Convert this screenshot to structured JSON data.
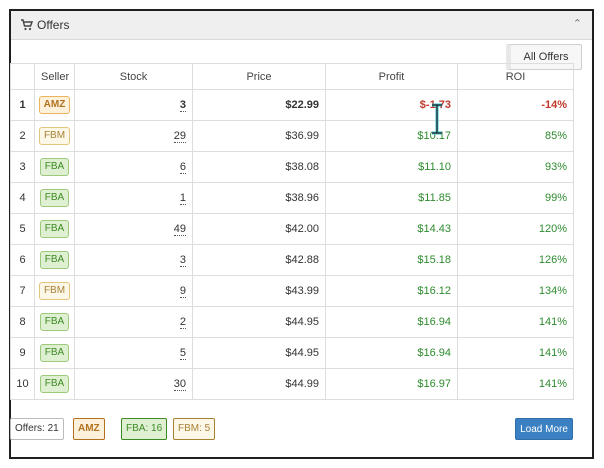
{
  "panel": {
    "title": "Offers",
    "collapse_icon": "chevron-up-icon",
    "cart_icon": "cart-icon"
  },
  "toolbar": {
    "all_offers_label": "All Offers"
  },
  "table": {
    "headers": [
      "",
      "Seller",
      "Stock",
      "Price",
      "Profit",
      "ROI"
    ],
    "rows": [
      {
        "idx": "1",
        "seller": "AMZ",
        "stock": "3",
        "price": "$22.99",
        "profit": "$-1.73",
        "roi": "-14%",
        "negative": true
      },
      {
        "idx": "2",
        "seller": "FBM",
        "stock": "29",
        "price": "$36.99",
        "profit": "$10.17",
        "roi": "85%"
      },
      {
        "idx": "3",
        "seller": "FBA",
        "stock": "6",
        "price": "$38.08",
        "profit": "$11.10",
        "roi": "93%"
      },
      {
        "idx": "4",
        "seller": "FBA",
        "stock": "1",
        "price": "$38.96",
        "profit": "$11.85",
        "roi": "99%"
      },
      {
        "idx": "5",
        "seller": "FBA",
        "stock": "49",
        "price": "$42.00",
        "profit": "$14.43",
        "roi": "120%"
      },
      {
        "idx": "6",
        "seller": "FBA",
        "stock": "3",
        "price": "$42.88",
        "profit": "$15.18",
        "roi": "126%"
      },
      {
        "idx": "7",
        "seller": "FBM",
        "stock": "9",
        "price": "$43.99",
        "profit": "$16.12",
        "roi": "134%"
      },
      {
        "idx": "8",
        "seller": "FBA",
        "stock": "2",
        "price": "$44.95",
        "profit": "$16.94",
        "roi": "141%"
      },
      {
        "idx": "9",
        "seller": "FBA",
        "stock": "5",
        "price": "$44.95",
        "profit": "$16.94",
        "roi": "141%"
      },
      {
        "idx": "10",
        "seller": "FBA",
        "stock": "30",
        "price": "$44.99",
        "profit": "$16.97",
        "roi": "141%"
      }
    ]
  },
  "footer": {
    "offers_count": "Offers: 21",
    "amz": "AMZ",
    "fba": "FBA: 16",
    "fbm": "FBM: 5",
    "load_more": "Load More"
  },
  "colors": {
    "positive": "#2e8b2e",
    "negative": "#c0392b",
    "button_primary": "#3a80c3"
  }
}
